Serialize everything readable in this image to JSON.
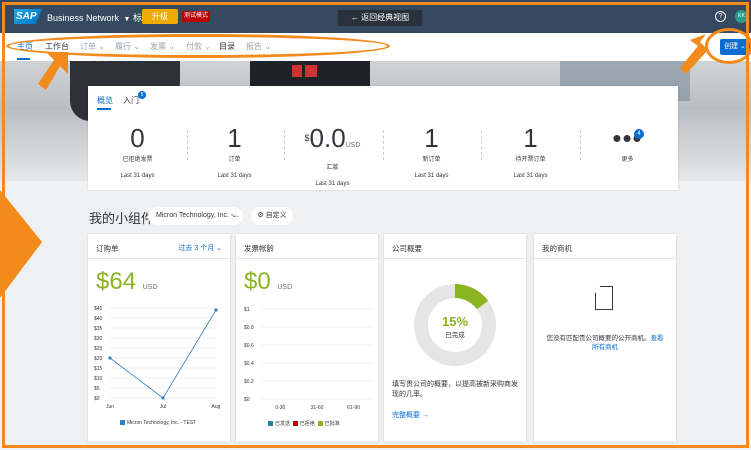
{
  "shell": {
    "logo": "SAP",
    "brand": "Business Network",
    "account_type": "标准帐户",
    "upgrade_label": "升级",
    "test_mode": "测试模式",
    "classic_view": "← 返回经典视图",
    "help": "?",
    "avatar_initials": "KK"
  },
  "nav": {
    "items": [
      {
        "label": "主页"
      },
      {
        "label": "工作台"
      },
      {
        "label": "订单 ⌄"
      },
      {
        "label": "履行 ⌄"
      },
      {
        "label": "发票 ⌄"
      },
      {
        "label": "付款 ⌄"
      },
      {
        "label": "目录"
      },
      {
        "label": "报告 ⌄"
      }
    ],
    "create_label": "创建 ⌄"
  },
  "overview": {
    "tabs": [
      {
        "label": "概览"
      },
      {
        "label": "入门"
      }
    ],
    "onboarding_badge": "5",
    "kpis": [
      {
        "value": "0",
        "label": "已拒绝发票",
        "period": "Last 31 days"
      },
      {
        "value": "1",
        "label": "订单",
        "period": "Last 31 days"
      },
      {
        "value": "0.0",
        "currency": "$",
        "unit": "USD",
        "label": "汇款",
        "period": "Last 31 days"
      },
      {
        "value": "1",
        "label": "新订单",
        "period": "Last 31 days"
      },
      {
        "value": "1",
        "label": "待开票订单",
        "period": "Last 31 days"
      },
      {
        "value": "•••",
        "label": "更多",
        "badge": "4"
      }
    ]
  },
  "widgets": {
    "title": "我的小组件",
    "company": "Micron Technology, Inc. -...",
    "customize": "自定义",
    "cards": {
      "po": {
        "title": "订购单",
        "range": "过去 3 个月 ⌄",
        "amount": "$64",
        "currency": "USD",
        "legend": "Micron Technology, Inc. - TEST"
      },
      "aging": {
        "title": "发票帐龄",
        "amount": "$0",
        "currency": "USD",
        "legend": [
          "已发送",
          "已拒绝",
          "已批准"
        ]
      },
      "profile": {
        "title": "公司概要",
        "percent": "15%",
        "percent_label": "已完成",
        "description": "填写贵公司的概要，以提高被新采购商发现的几率。",
        "link": "完整概要 →"
      },
      "opportunities": {
        "title": "我的商机",
        "message": "您没有匹配贵公司概要的公开商机。",
        "link": "查看所有商机"
      }
    }
  },
  "chart_data": [
    {
      "type": "line",
      "title": "订购单",
      "x": [
        "Jun",
        "Jul",
        "Aug"
      ],
      "series": [
        {
          "name": "Micron Technology, Inc. - TEST",
          "values": [
            20,
            0,
            44
          ]
        }
      ],
      "yticks": [
        "$45",
        "$40",
        "$35",
        "$30",
        "$25",
        "$20",
        "$15",
        "$10",
        "$5",
        "$0"
      ],
      "ylim": [
        0,
        45
      ],
      "color": "#2f7fc1"
    },
    {
      "type": "bar",
      "title": "发票帐龄",
      "categories": [
        "0-30",
        "31-60",
        "61-90"
      ],
      "series": [
        {
          "name": "已发送",
          "values": [
            0,
            0,
            0
          ]
        },
        {
          "name": "已拒绝",
          "values": [
            0,
            0,
            0
          ]
        },
        {
          "name": "已批准",
          "values": [
            0,
            0,
            0
          ]
        }
      ],
      "yticks": [
        "$1",
        "$0.8",
        "$0.6",
        "$0.4",
        "$0.2",
        "$0"
      ],
      "ylim": [
        0,
        1
      ],
      "colors": [
        "#1e8a9c",
        "#bb0000",
        "#8bb421"
      ]
    },
    {
      "type": "pie",
      "title": "公司概要",
      "values": [
        15,
        85
      ],
      "colors": [
        "#8bb421",
        "#e5e5e5"
      ]
    }
  ],
  "colors": {
    "shell": "#354a5f",
    "accent": "#0a6ed1",
    "highlight": "#f28a1c",
    "positive": "#8bb421"
  }
}
